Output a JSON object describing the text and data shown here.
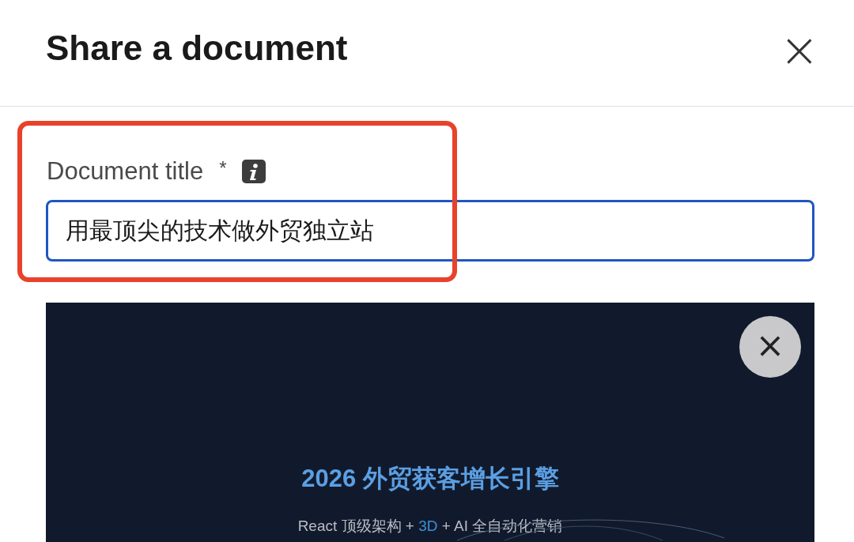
{
  "dialog": {
    "title": "Share a document",
    "close": "×"
  },
  "field": {
    "label": "Document title",
    "required_mark": "*",
    "value": "用最顶尖的技术做外贸独立站",
    "highlighted": true,
    "focused": true
  },
  "preview": {
    "remove": "×",
    "headline": "2026 外贸获客增长引擎",
    "subtitle": [
      {
        "text": "React 顶级架构 + ",
        "kind": "plain"
      },
      {
        "text": "3D",
        "kind": "accent"
      },
      {
        "text": " + AI 全自动化营销",
        "kind": "plain"
      }
    ]
  }
}
